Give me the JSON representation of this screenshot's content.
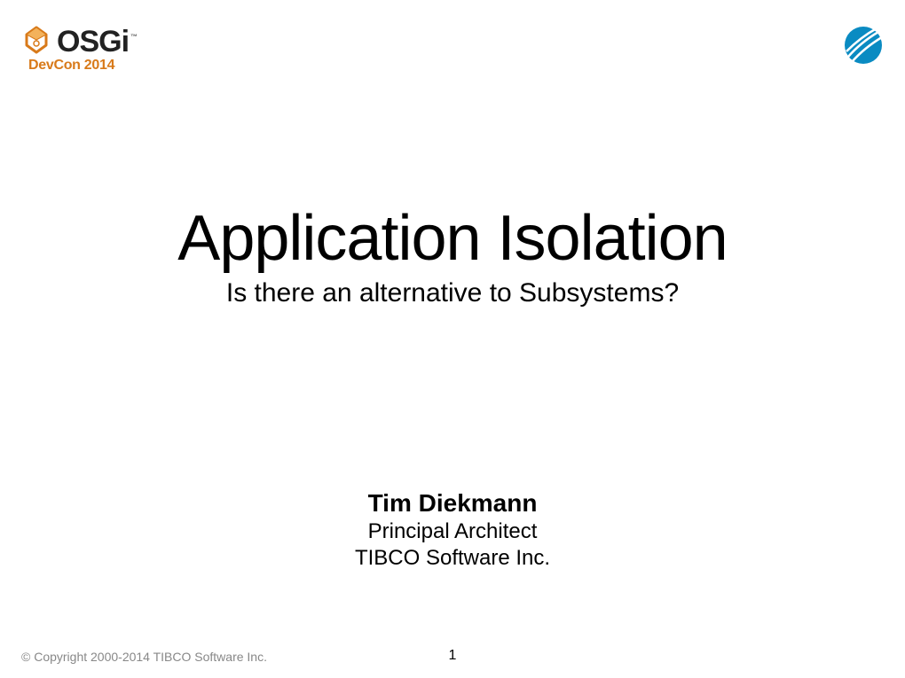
{
  "header": {
    "brand_primary": "OSGi",
    "brand_tm": "™",
    "brand_secondary": "DevCon 2014"
  },
  "main": {
    "title": "Application Isolation",
    "subtitle": "Is there an alternative to Subsystems?"
  },
  "author": {
    "name": "Tim Diekmann",
    "role": "Principal Architect",
    "company": "TIBCO Software Inc."
  },
  "footer": {
    "copyright": "© Copyright 2000-2014 TIBCO Software Inc.",
    "page": "1"
  },
  "colors": {
    "accent_orange": "#d87a1a",
    "accent_blue": "#0a8bc2"
  },
  "icons": {
    "osgi_logo": "osgi-logo-icon",
    "tibco_logo": "tibco-globe-icon"
  }
}
